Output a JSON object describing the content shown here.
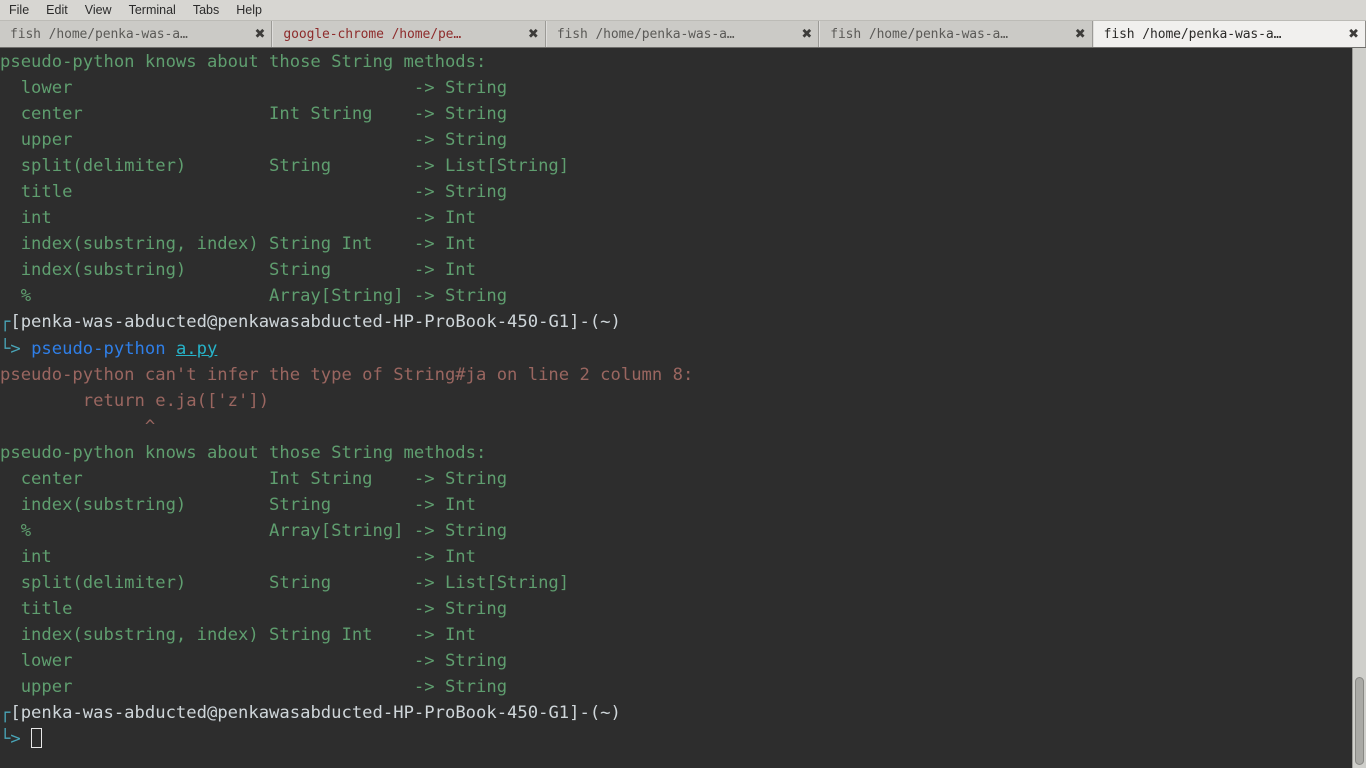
{
  "window": {
    "menu": [
      {
        "label": "File"
      },
      {
        "label": "Edit"
      },
      {
        "label": "View"
      },
      {
        "label": "Terminal"
      },
      {
        "label": "Tabs"
      },
      {
        "label": "Help"
      }
    ],
    "tabs": [
      {
        "label": "fish    /home/penka-was-a…",
        "close": "✖",
        "active": false,
        "bell": false
      },
      {
        "label": "google-chrome   /home/pe…",
        "close": "✖",
        "active": false,
        "bell": true
      },
      {
        "label": "fish    /home/penka-was-a…",
        "close": "✖",
        "active": false,
        "bell": false
      },
      {
        "label": "fish    /home/penka-was-a…",
        "close": "✖",
        "active": false,
        "bell": false
      },
      {
        "label": "fish    /home/penka-was-a…",
        "close": "✖",
        "active": true,
        "bell": false
      }
    ]
  },
  "colors": {
    "terminal_background": "#2d2d2d",
    "green": "#5f9e6f",
    "error": "#9a6660",
    "prompt_text": "#cfd6da",
    "prompt_symbol": "#49a5b8",
    "command": "#2f7fe8",
    "filename": "#26b3c9",
    "menubar_background": "#d7d6d2",
    "tabbar_background": "#b9b8b3",
    "active_tab_background": "#f1f0ee",
    "bell_tab_text": "#8e2c2c"
  },
  "terminal": {
    "block1": {
      "heading": "pseudo-python knows about those String methods:",
      "rows": [
        {
          "name": "lower",
          "args": "",
          "ret": "-> String"
        },
        {
          "name": "center",
          "args": "Int String",
          "ret": "-> String"
        },
        {
          "name": "upper",
          "args": "",
          "ret": "-> String"
        },
        {
          "name": "split(delimiter)",
          "args": "String",
          "ret": "-> List[String]"
        },
        {
          "name": "title",
          "args": "",
          "ret": "-> String"
        },
        {
          "name": "int",
          "args": "",
          "ret": "-> Int"
        },
        {
          "name": "index(substring, index)",
          "args": "String Int",
          "ret": "-> Int"
        },
        {
          "name": "index(substring)",
          "args": "String",
          "ret": "-> Int"
        },
        {
          "name": "%",
          "args": "Array[String]",
          "ret": "-> String"
        }
      ]
    },
    "prompt1": {
      "corner_top": "┌",
      "corner_bottom": "└",
      "line": "[penka-was-abducted@penkawasabducted-HP-ProBook-450-G1]-(~)",
      "arrow": ">",
      "command": "pseudo-python",
      "argument": "a.py"
    },
    "error": {
      "message": "pseudo-python can't infer the type of String#ja on line 2 column 8:",
      "source_line": "        return e.ja(['z'])",
      "caret_line": "              ^"
    },
    "block2": {
      "heading": "pseudo-python knows about those String methods:",
      "rows": [
        {
          "name": "center",
          "args": "Int String",
          "ret": "-> String"
        },
        {
          "name": "index(substring)",
          "args": "String",
          "ret": "-> Int"
        },
        {
          "name": "%",
          "args": "Array[String]",
          "ret": "-> String"
        },
        {
          "name": "int",
          "args": "",
          "ret": "-> Int"
        },
        {
          "name": "split(delimiter)",
          "args": "String",
          "ret": "-> List[String]"
        },
        {
          "name": "title",
          "args": "",
          "ret": "-> String"
        },
        {
          "name": "index(substring, index)",
          "args": "String Int",
          "ret": "-> Int"
        },
        {
          "name": "lower",
          "args": "",
          "ret": "-> String"
        },
        {
          "name": "upper",
          "args": "",
          "ret": "-> String"
        }
      ]
    },
    "prompt2": {
      "corner_top": "┌",
      "corner_bottom": "└",
      "line": "[penka-was-abducted@penkawasabducted-HP-ProBook-450-G1]-(~)",
      "arrow": ">",
      "command": ""
    }
  }
}
